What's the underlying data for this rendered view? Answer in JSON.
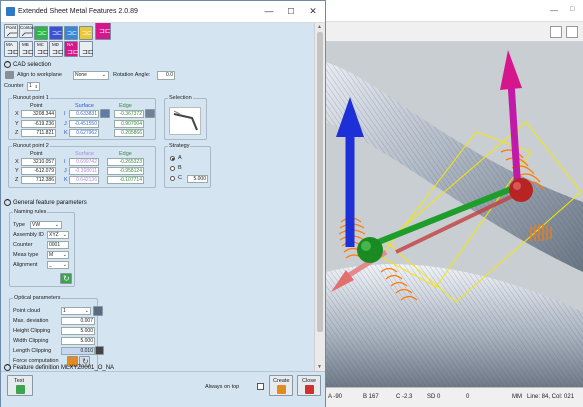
{
  "window": {
    "title": "Extended Sheet Metal Features 2.0.89",
    "minimize": "—",
    "maximize": "☐",
    "close": "✕"
  },
  "toolbar": {
    "row1": [
      "Point",
      "Contour",
      "",
      "",
      "",
      "",
      ""
    ],
    "row2": [
      "MA",
      "MB",
      "MC",
      "MD",
      "NA",
      ""
    ]
  },
  "cad": {
    "section": "CAD selection",
    "align_label": "Align to workplane",
    "align_value": "None",
    "rotation_label": "Rotation Angle:",
    "rotation_value": "0.0",
    "counter_label": "Counter",
    "counter_value": "1"
  },
  "runout1": {
    "title": "Runout point 1",
    "h_point": "Point",
    "h_surface": "Surface",
    "h_edge": "Edge",
    "rows": [
      {
        "axis": "X",
        "point": "3208.344",
        "sl": "I",
        "surface": "0.633831",
        "edge": "-0.367372"
      },
      {
        "axis": "Y",
        "point": "-619.236",
        "sl": "J",
        "surface": "-0.451550",
        "edge": "0.907004"
      },
      {
        "axis": "Z",
        "point": "711.821",
        "sl": "K",
        "surface": "0.627962",
        "edge": "0.205866"
      }
    ]
  },
  "selection": {
    "title": "Selection"
  },
  "runout2": {
    "title": "Runout point 2",
    "h_point": "Point",
    "h_surface": "Surface",
    "h_edge": "Edge",
    "rows": [
      {
        "axis": "X",
        "point": "3210.057",
        "sl": "I",
        "surface": "0.699742",
        "edge": "-0.265323"
      },
      {
        "axis": "Y",
        "point": "-612.079",
        "sl": "J",
        "surface": "-0.368011",
        "edge": "-0.958124"
      },
      {
        "axis": "Z",
        "point": "712.386",
        "sl": "K",
        "surface": "0.642136",
        "edge": "-0.107714"
      }
    ]
  },
  "strategy": {
    "title": "Strategy",
    "options": [
      "A",
      "B",
      "C"
    ],
    "selected": "A",
    "c_value": "5.000"
  },
  "general": {
    "section": "General feature parameters"
  },
  "naming": {
    "title": "Naming rules",
    "type_label": "Type",
    "type_value": "VW",
    "assembly_label": "Assembly ID",
    "assembly_value": "XYZ",
    "counter_label": "Counter",
    "counter_value": "0001",
    "meas_label": "Meas type",
    "meas_value": "M",
    "align_label": "Alignment",
    "align_value": "_"
  },
  "optical": {
    "title": "Optical parameters",
    "cloud_label": "Point cloud",
    "cloud_value": "1",
    "maxdev_label": "Max. deviation",
    "maxdev_value": "0.007",
    "height_label": "Height Clipping",
    "height_value": "5.000",
    "width_label": "Width Clipping",
    "width_value": "5.000",
    "length_label": "Length Clipping",
    "length_value": "0.010",
    "force_label": "Force computation"
  },
  "feature_def": {
    "section": "Feature definition MLXYZ0001_O_NA"
  },
  "bottom": {
    "test": "Test",
    "always_on_top": "Always on top",
    "create": "Create",
    "close": "Close"
  },
  "status": {
    "a": "A -90",
    "b": "B 167",
    "c": "C -2.3",
    "sd": "SD 0",
    "zero": "0",
    "mm": "MM",
    "line": "Line: 84, Col: 021"
  },
  "colors": {
    "panel_bg": "#d4e4f0",
    "accent_magenta": "#d6168c",
    "arrow_blue": "#1d2fd6",
    "arrow_green": "#1f9d2a",
    "pad_orange": "#ff7b00"
  }
}
